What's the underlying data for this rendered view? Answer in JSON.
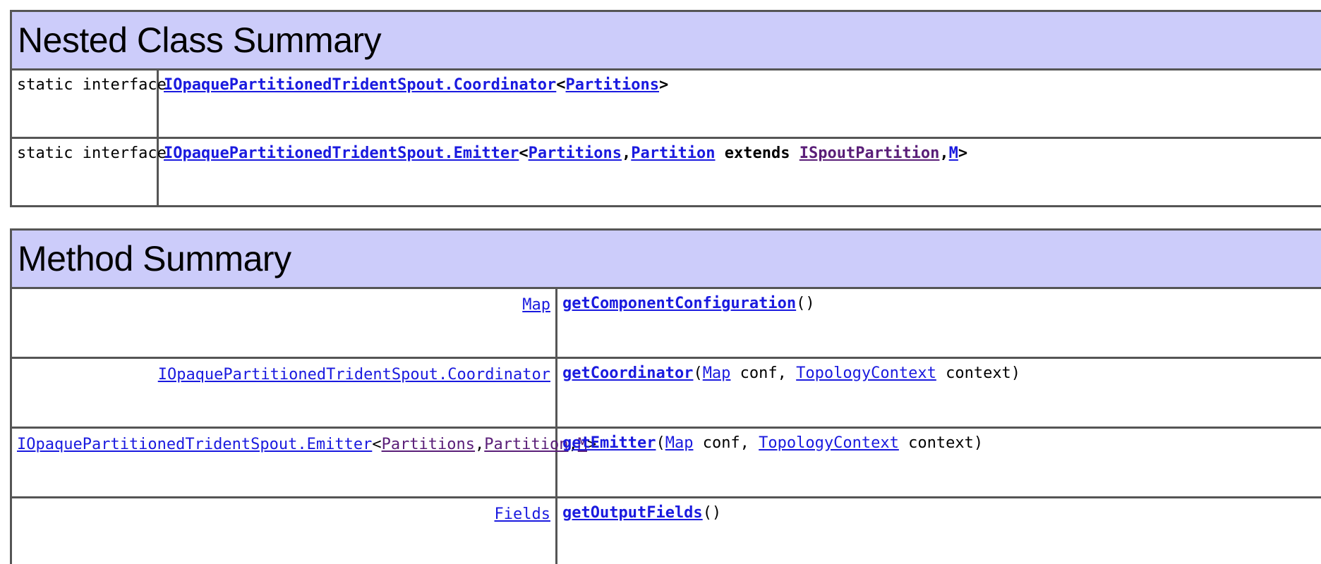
{
  "nested": {
    "title": "Nested Class Summary",
    "rows": [
      {
        "modifier": "static interface",
        "class_link": "IOpaquePartitionedTridentSpout.Coordinator",
        "lt": "<",
        "param1": "Partitions",
        "gt": ">"
      },
      {
        "modifier": "static interface",
        "class_link": "IOpaquePartitionedTridentSpout.Emitter",
        "lt": "<",
        "param1": "Partitions",
        "comma1": ",",
        "param2": "Partition",
        "extends_kw": " extends ",
        "param3": "ISpoutPartition",
        "comma2": ",",
        "param4": "M",
        "gt": ">"
      }
    ]
  },
  "method": {
    "title": "Method Summary",
    "rows": [
      {
        "return_type": "Map",
        "method_name": "getComponentConfiguration",
        "params_text": "()"
      },
      {
        "return_type": "IOpaquePartitionedTridentSpout.Coordinator",
        "method_name": "getCoordinator",
        "open": "(",
        "p1_type": "Map",
        "p1_name": " conf, ",
        "p2_type": "TopologyContext",
        "p2_name": " context)"
      },
      {
        "return_type": "IOpaquePartitionedTridentSpout.Emitter",
        "rt_lt": "<",
        "rt_p1": "Partitions",
        "rt_c1": ",",
        "rt_p2": "Partition",
        "rt_c2": ",",
        "rt_p3": "M",
        "rt_gt": ">",
        "method_name": "getEmitter",
        "open": "(",
        "p1_type": "Map",
        "p1_name": " conf, ",
        "p2_type": "TopologyContext",
        "p2_name": " context)"
      },
      {
        "return_type": "Fields",
        "method_name": "getOutputFields",
        "params_text": "()"
      }
    ]
  },
  "colors": {
    "header_bg": "#ccccfa",
    "link": "#1a1adf",
    "visited_link": "#5a1e78",
    "border": "#555555"
  }
}
